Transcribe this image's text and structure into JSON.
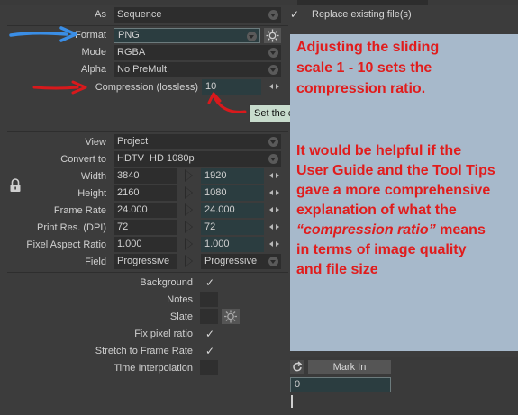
{
  "top": {
    "as_label": "As",
    "as_value": "Sequence",
    "replace_label": "Replace existing file(s)"
  },
  "format": {
    "format_label": "Format",
    "format_value": "PNG",
    "mode_label": "Mode",
    "mode_value": "RGBA",
    "alpha_label": "Alpha",
    "alpha_value": "No PreMult.",
    "compression_label": "Compression (lossless)",
    "compression_value": "10",
    "tooltip": "Set the compression ratio"
  },
  "video": {
    "view_label": "View",
    "view_value": "Project",
    "convert_label": "Convert to",
    "convert_value": "HDTV  HD 1080p",
    "rows": [
      {
        "label": "Width",
        "source": "3840",
        "target": "1920"
      },
      {
        "label": "Height",
        "source": "2160",
        "target": "1080"
      },
      {
        "label": "Frame Rate",
        "source": "24.000",
        "target": "24.000"
      },
      {
        "label": "Print Res. (DPI)",
        "source": "72",
        "target": "72"
      },
      {
        "label": "Pixel Aspect Ratio",
        "source": "1.000",
        "target": "1.000"
      },
      {
        "label": "Field",
        "source": "Progressive",
        "target": "Progressive"
      }
    ]
  },
  "options": {
    "background": "Background",
    "notes": "Notes",
    "slate": "Slate",
    "fix_pixel_ratio": "Fix pixel ratio",
    "stretch": "Stretch to Frame Rate",
    "time_interp": "Time Interpolation"
  },
  "mark": {
    "mark_in_label": "Mark In",
    "mark_in_value": "0"
  },
  "annotation": {
    "line1": "Adjusting the sliding",
    "line2": "scale 1 - 10 sets the",
    "line3": "compression ratio.",
    "p1": "It would be helpful if the",
    "p2": "User Guide and the Tool Tips",
    "p3": "gave a more comprehensive",
    "p4": "explanation of what the",
    "p5_italic": "“compression ratio”",
    "p5_rest": " means",
    "p6": "in terms of image quality",
    "p7": "and file size"
  },
  "colors": {
    "arrow_blue": "#3a8ee6",
    "arrow_red": "#d8191c",
    "annotation_text": "#e11c1c",
    "annotation_bg": "#a7b9cb"
  }
}
